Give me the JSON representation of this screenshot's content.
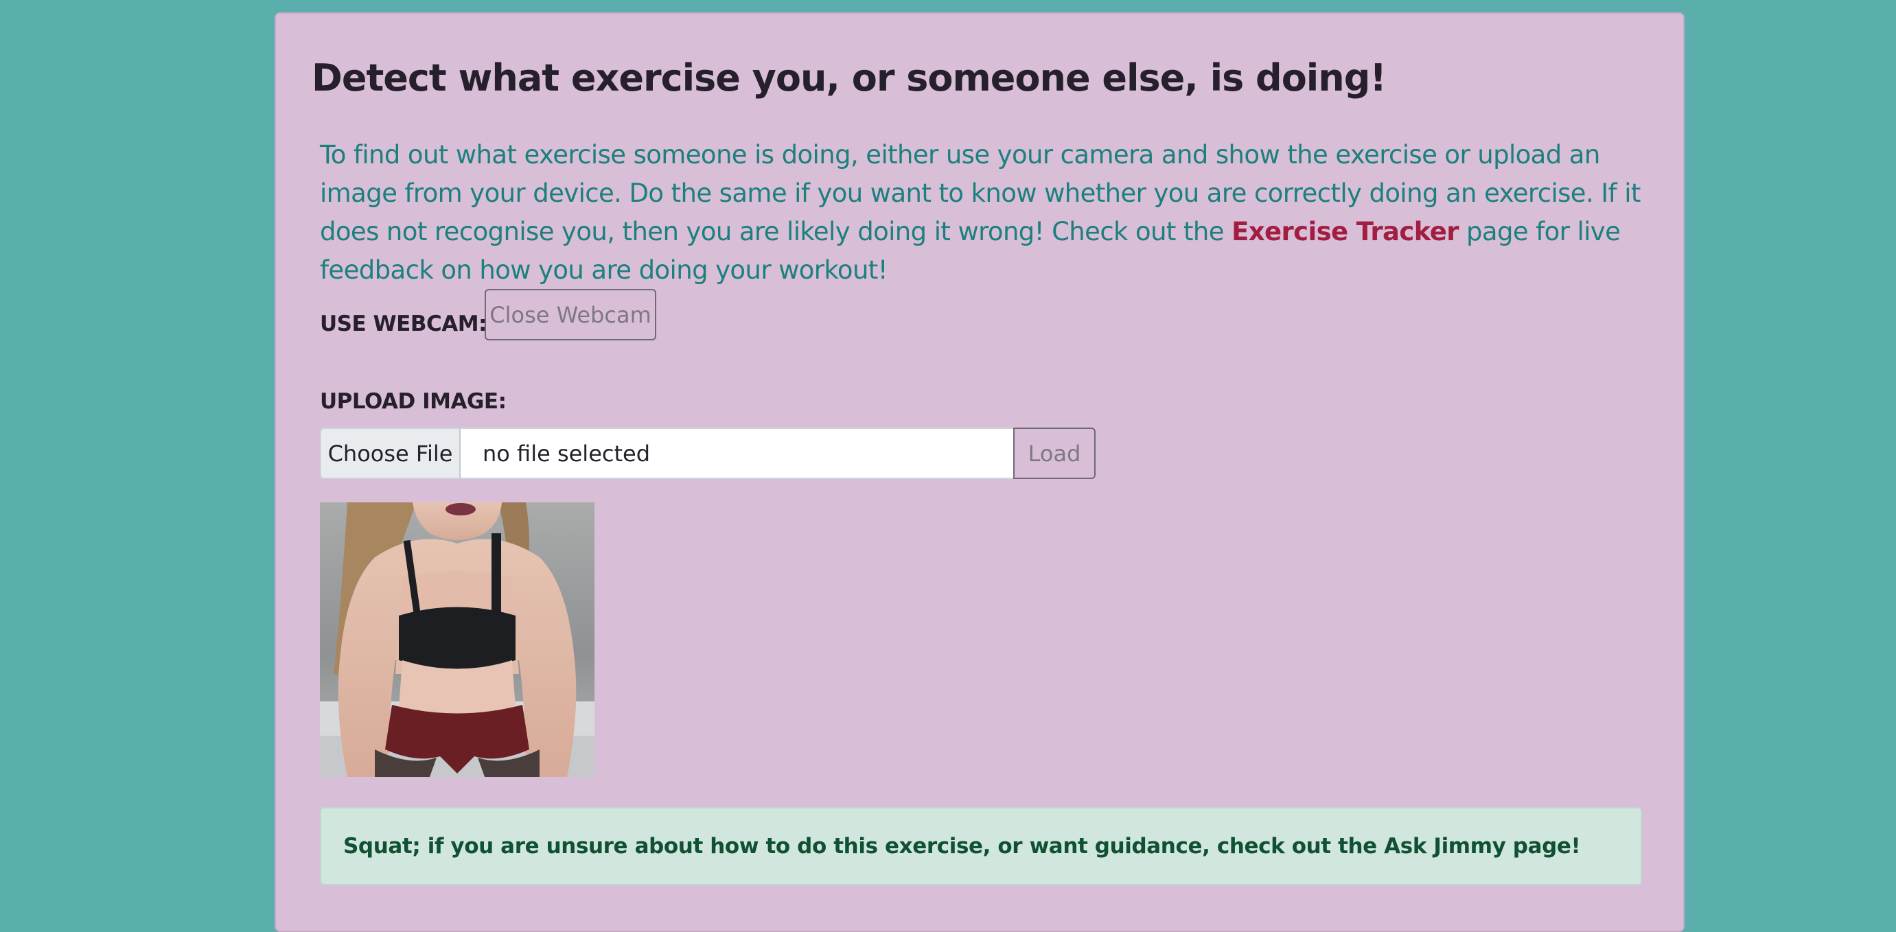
{
  "page": {
    "title": "Detect what exercise you, or someone else, is doing!"
  },
  "intro": {
    "text_before": "To find out what exercise someone is doing, either use your camera and show the exercise or upload an image from your device. Do the same if you want to know whether you are correctly doing an exercise. If it does not recognise you, then you are likely doing it wrong! Check out the ",
    "link_label": "Exercise Tracker",
    "text_after": " page for live feedback on how you are doing your workout!"
  },
  "webcam": {
    "label": "USE WEBCAM:",
    "button_label": "Close Webcam"
  },
  "upload": {
    "label": "UPLOAD IMAGE:",
    "choose_label": "Choose File",
    "file_status": "no file selected",
    "load_label": "Load"
  },
  "result": {
    "message": "Squat; if you are unsure about how to do this exercise, or want guidance, check out the Ask Jimmy page!"
  },
  "colors": {
    "page_background": "#5aaeab",
    "card_background": "#d9bed7",
    "intro_text": "#1b807e",
    "link": "#a21e40",
    "alert_background": "#d1e7dd",
    "alert_text": "#0f5132"
  },
  "preview_image": {
    "icon": "uploaded-photo"
  }
}
